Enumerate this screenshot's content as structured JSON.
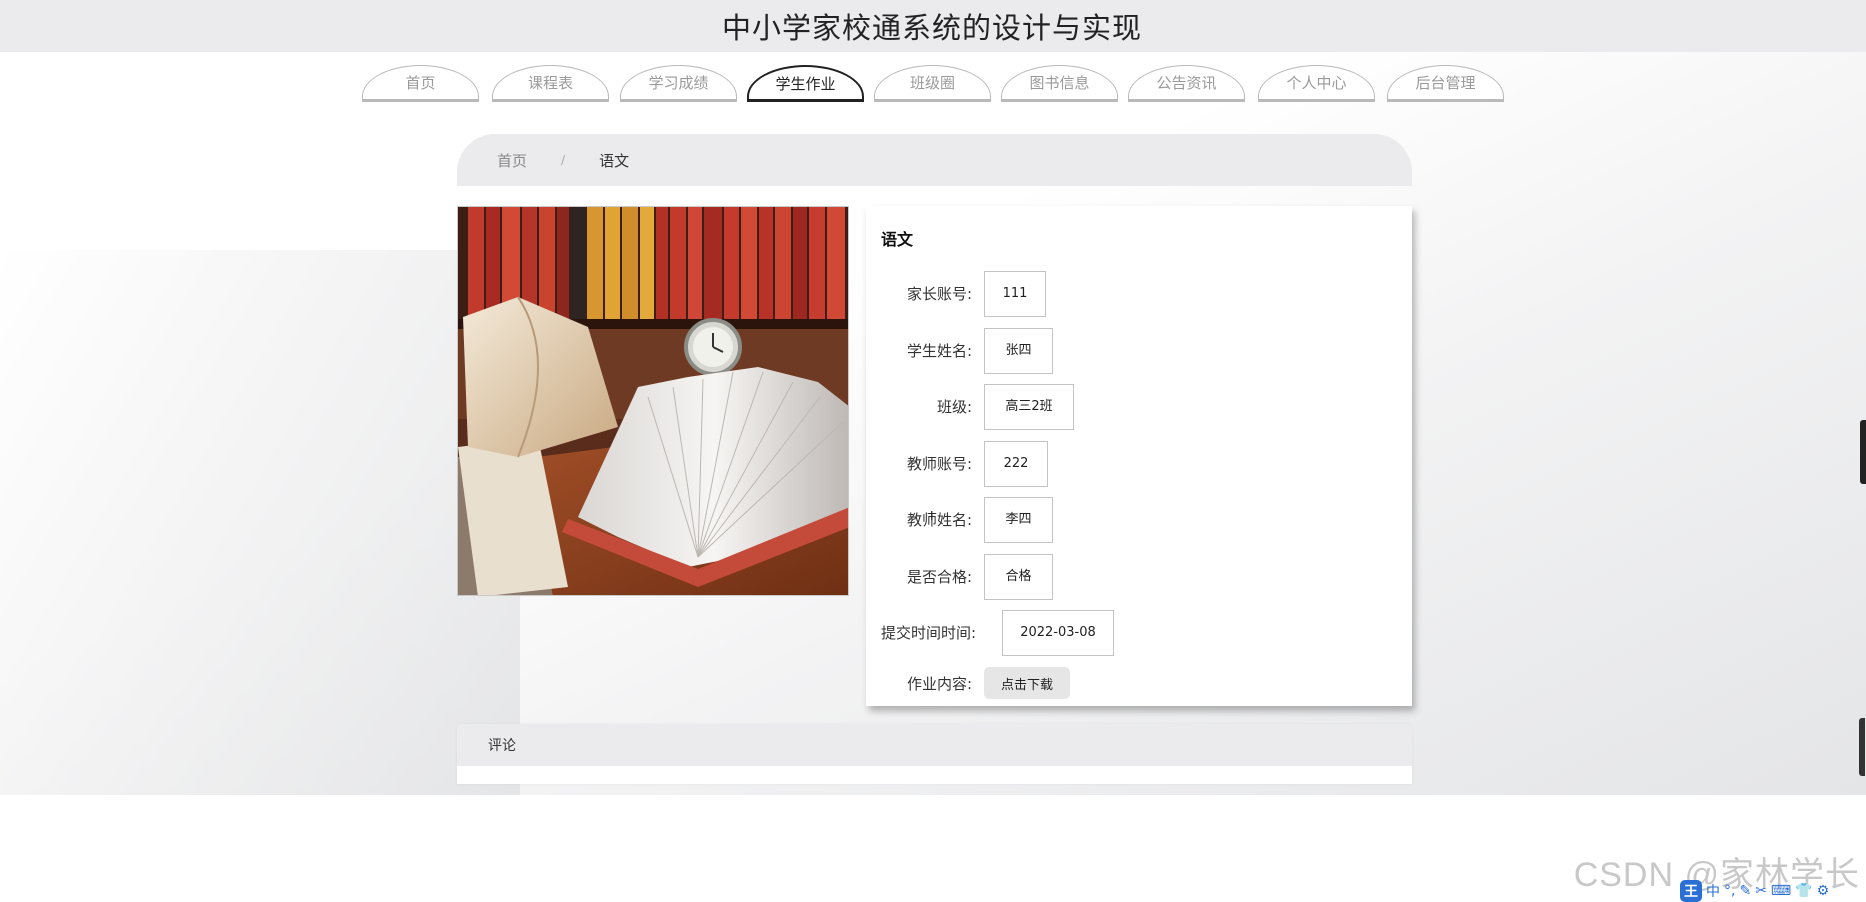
{
  "site": {
    "title": "中小学家校通系统的设计与实现"
  },
  "nav": {
    "tabs": [
      {
        "label": "首页",
        "active": false
      },
      {
        "label": "课程表",
        "active": false
      },
      {
        "label": "学习成绩",
        "active": false
      },
      {
        "label": "学生作业",
        "active": true
      },
      {
        "label": "班级圈",
        "active": false
      },
      {
        "label": "图书信息",
        "active": false
      },
      {
        "label": "公告资讯",
        "active": false
      },
      {
        "label": "个人中心",
        "active": false
      },
      {
        "label": "后台管理",
        "active": false
      }
    ]
  },
  "breadcrumb": {
    "home": "首页",
    "separator": "/",
    "current": "语文"
  },
  "detail": {
    "title": "语文",
    "fields": [
      {
        "label": "家长账号:",
        "value": "111"
      },
      {
        "label": "学生姓名:",
        "value": "张四"
      },
      {
        "label": "班级:",
        "value": "高三2班"
      },
      {
        "label": "教师账号:",
        "value": "222"
      },
      {
        "label": "教师姓名:",
        "value": "李四"
      },
      {
        "label": "是否合格:",
        "value": "合格"
      },
      {
        "label": "提交时间时间:",
        "value": "2022-03-08"
      }
    ],
    "content_label": "作业内容:",
    "download_label": "点击下载"
  },
  "comments": {
    "title": "评论"
  },
  "watermark": "CSDN @家林学长",
  "ime": {
    "logo": "王",
    "items": [
      "中",
      "°,",
      "✎",
      "✂",
      "⌨",
      "👕",
      "⚙"
    ]
  },
  "colors": {
    "header_bg": "#ebebed",
    "active_tab": "#222222",
    "inactive_tab": "#9a9a9a"
  }
}
